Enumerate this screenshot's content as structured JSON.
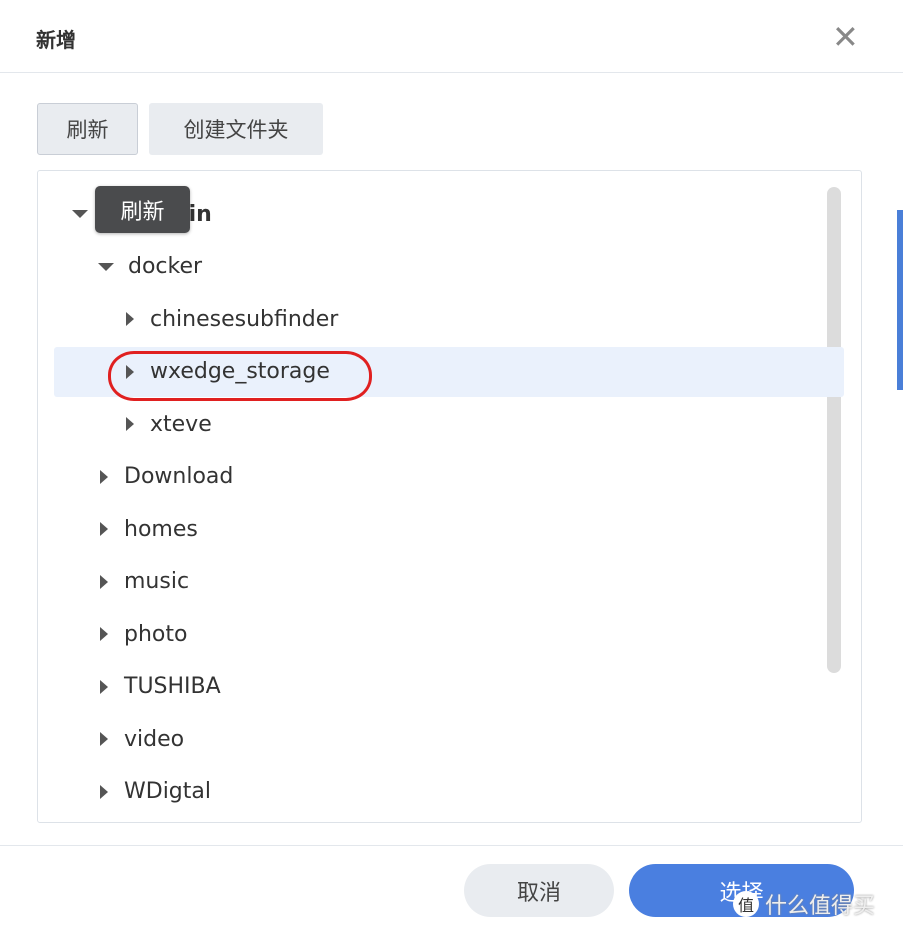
{
  "dialog": {
    "title": "新增",
    "close_icon": "close-icon"
  },
  "toolbar": {
    "refresh": "刷新",
    "create_folder": "创建文件夹"
  },
  "tooltip": "刷新",
  "tree": [
    {
      "label": "Hengyjin",
      "level": 0,
      "expanded": true
    },
    {
      "label": "docker",
      "level": 1,
      "expanded": true
    },
    {
      "label": "chinesesubfinder",
      "level": 2,
      "expanded": false
    },
    {
      "label": "wxedge_storage",
      "level": 2,
      "expanded": false,
      "selected": true
    },
    {
      "label": "xteve",
      "level": 2,
      "expanded": false
    },
    {
      "label": "Download",
      "level": 1,
      "expanded": false
    },
    {
      "label": "homes",
      "level": 1,
      "expanded": false
    },
    {
      "label": "music",
      "level": 1,
      "expanded": false
    },
    {
      "label": "photo",
      "level": 1,
      "expanded": false
    },
    {
      "label": "TUSHIBA",
      "level": 1,
      "expanded": false
    },
    {
      "label": "video",
      "level": 1,
      "expanded": false
    },
    {
      "label": "WDigtal",
      "level": 1,
      "expanded": false
    }
  ],
  "footer": {
    "cancel": "取消",
    "select": "选择"
  },
  "watermark": {
    "badge": "值",
    "text": "什么值得买"
  },
  "colors": {
    "primary": "#4a7fe0",
    "highlight": "#e02020",
    "selected_row": "#eaf1fc"
  }
}
